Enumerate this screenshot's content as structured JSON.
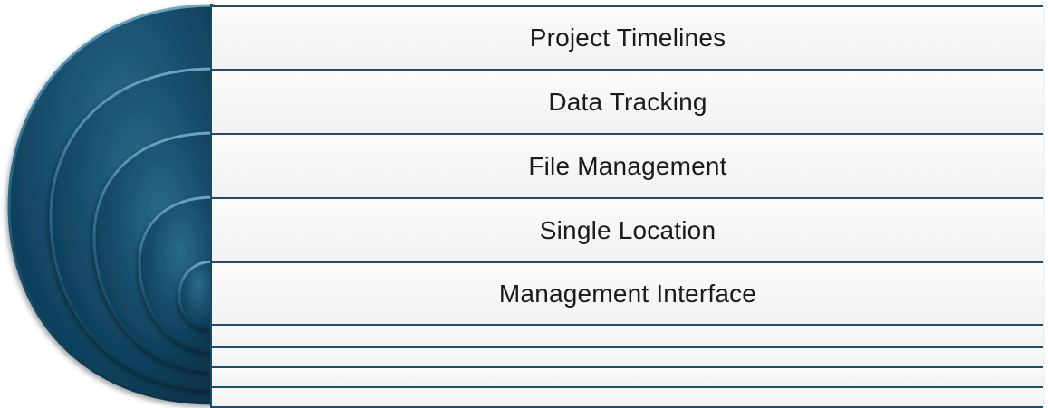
{
  "diagram": {
    "items": [
      {
        "label": "Project Timelines"
      },
      {
        "label": "Data Tracking"
      },
      {
        "label": "File Management"
      },
      {
        "label": "Single Location"
      },
      {
        "label": "Management Interface"
      }
    ],
    "extra_empty_bars": 4
  },
  "colors": {
    "arc_dark": "#0e3c56",
    "arc_mid": "#1f5f80",
    "arc_light": "#4f88a8",
    "bar_fill": "#f4f4f4",
    "bar_border": "#1b4f6b",
    "text": "#1a1a1a"
  }
}
